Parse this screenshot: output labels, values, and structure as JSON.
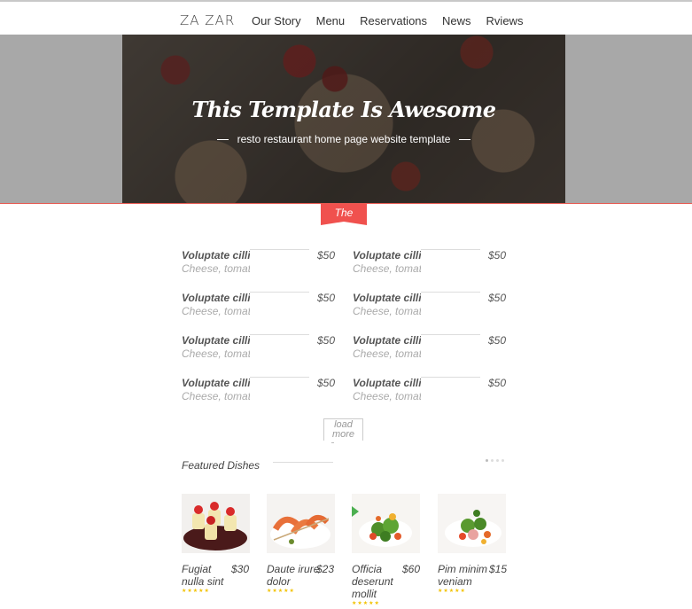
{
  "brand": {
    "logo": "ZA ZAR"
  },
  "nav": {
    "items": [
      "Our Story",
      "Menu",
      "Reservations",
      "News",
      "Rviews"
    ]
  },
  "hero": {
    "title": "This Template Is Awesome",
    "subtitle": "resto restaurant home page website template"
  },
  "section": {
    "ribbon_label": "The"
  },
  "menu": {
    "items": [
      {
        "name": "Voluptate cilli",
        "desc": "Cheese, tomat",
        "price": "$50"
      },
      {
        "name": "Voluptate cilli",
        "desc": "Cheese, tomat",
        "price": "$50"
      },
      {
        "name": "Voluptate cilli",
        "desc": "Cheese, tomat",
        "price": "$50"
      },
      {
        "name": "Voluptate cilli",
        "desc": "Cheese, tomat",
        "price": "$50"
      },
      {
        "name": "Voluptate cilli",
        "desc": "Cheese, tomat",
        "price": "$50"
      },
      {
        "name": "Voluptate cilli",
        "desc": "Cheese, tomat",
        "price": "$50"
      },
      {
        "name": "Voluptate cilli",
        "desc": "Cheese, tomat",
        "price": "$50"
      },
      {
        "name": "Voluptate cilli",
        "desc": "Cheese, tomat",
        "price": "$50"
      }
    ],
    "load_more": "load more"
  },
  "featured": {
    "title": "Featured Dishes",
    "dishes": [
      {
        "name": "Fugiat nulla sint",
        "price": "$30",
        "stars": "★★★★★"
      },
      {
        "name": "Daute irure dolor",
        "price": "$23",
        "stars": "★★★★★"
      },
      {
        "name": "Officia deserunt mollit",
        "price": "$60",
        "stars": "★★★★★"
      },
      {
        "name": "Pim minim veniam",
        "price": "$15",
        "stars": "★★★★★"
      }
    ]
  },
  "colors": {
    "accent": "#f0514e",
    "star": "#f2c200"
  }
}
